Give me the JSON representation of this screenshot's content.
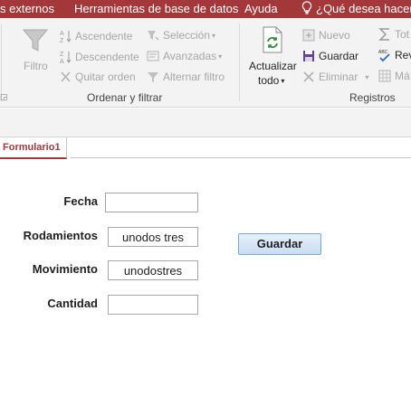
{
  "menu": {
    "items": [
      "s externos",
      "Herramientas de base de datos",
      "Ayuda",
      "¿Qué desea hacer?"
    ]
  },
  "ribbon": {
    "filter_label": "Filtro",
    "sort_filter": {
      "ascending": "Ascendente",
      "descending": "Descendente",
      "remove_sort": "Quitar orden",
      "selection": "Selección",
      "advanced": "Avanzadas",
      "toggle_filter": "Alternar filtro",
      "group_label": "Ordenar y filtrar"
    },
    "records": {
      "refresh_line1": "Actualizar",
      "refresh_line2": "todo",
      "new": "Nuevo",
      "save": "Guardar",
      "delete": "Eliminar",
      "totals": "Tot",
      "spelling": "Rev",
      "more": "Má",
      "group_label": "Registros"
    }
  },
  "document_tab": {
    "label": "Formulario1"
  },
  "form": {
    "fields": [
      {
        "label": "Fecha",
        "value": ""
      },
      {
        "label": "Rodamientos",
        "value": "unodos tres"
      },
      {
        "label": "Movimiento",
        "value": "unodostres"
      },
      {
        "label": "Cantidad",
        "value": ""
      }
    ],
    "save_button": "Guardar"
  },
  "colors": {
    "accent": "#a4373a",
    "ribbon_bg": "#f3f3f3",
    "button_border": "#7aa7d9"
  }
}
